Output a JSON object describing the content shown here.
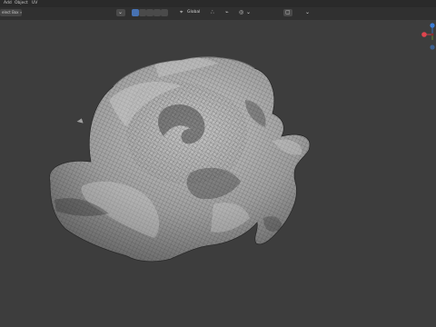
{
  "menubar": {
    "items": [
      {
        "id": "add",
        "label": "Add"
      },
      {
        "id": "object",
        "label": "Object"
      },
      {
        "id": "uv",
        "label": "UV"
      }
    ]
  },
  "header": {
    "select_mode_label": "elect Box ∙",
    "dropdown_arrow": "⌄",
    "transform_orientation": "Global",
    "orientation_icon": "⌖",
    "pivot_icon": "∴",
    "snap_icon": "⌁",
    "proportional_icon": "◎",
    "proportional_arrow": "⌄",
    "overlay_icon": "▢",
    "viewport_shading_arrow": "⌄"
  },
  "gizmo": {
    "x_label": "X",
    "y_label": "Y",
    "z_label": "Z",
    "x_color": "#e0444e",
    "y_color": "#6e9a2c",
    "z_color": "#3c7dd6"
  },
  "scene": {
    "object_name": "sculpted mesh",
    "mesh_base_color": "#9e9e9e",
    "wire_color": "#303030",
    "background_color": "#3d3d3d"
  }
}
